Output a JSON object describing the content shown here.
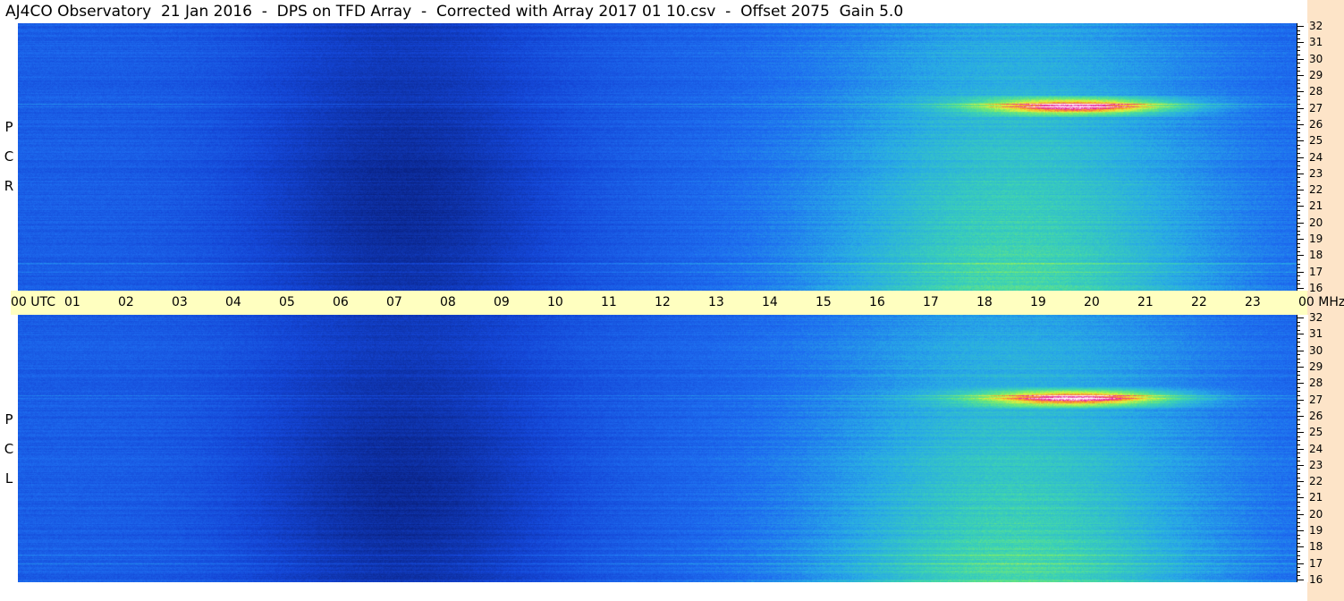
{
  "title": "AJ4CO Observatory  21 Jan 2016  -  DPS on TFD Array  -  Corrected with Array 2017 01 10.csv  -  Offset 2075  Gain 5.0",
  "panels": {
    "top": {
      "polarization": [
        "R",
        "C",
        "P"
      ]
    },
    "bottom": {
      "polarization": [
        "L",
        "C",
        "P"
      ]
    }
  },
  "time_axis": {
    "labels": [
      "00  UTC",
      "01",
      "02",
      "03",
      "04",
      "05",
      "06",
      "07",
      "08",
      "09",
      "10",
      "11",
      "12",
      "13",
      "14",
      "15",
      "16",
      "17",
      "18",
      "19",
      "20",
      "21",
      "22",
      "23",
      "00 MHz"
    ]
  },
  "freq_axis": {
    "unit": "MHz",
    "labels": [
      "32",
      "31",
      "30",
      "29",
      "28",
      "27",
      "26",
      "25",
      "24",
      "23",
      "22",
      "21",
      "20",
      "19",
      "18",
      "17",
      "16"
    ]
  },
  "colors": {
    "background_blue": "#1d5ae4",
    "dark_blue": "#0a1f7a",
    "time_axis_bg": "#ffffc0",
    "freq_strip_bg": "#fde4c8"
  }
}
